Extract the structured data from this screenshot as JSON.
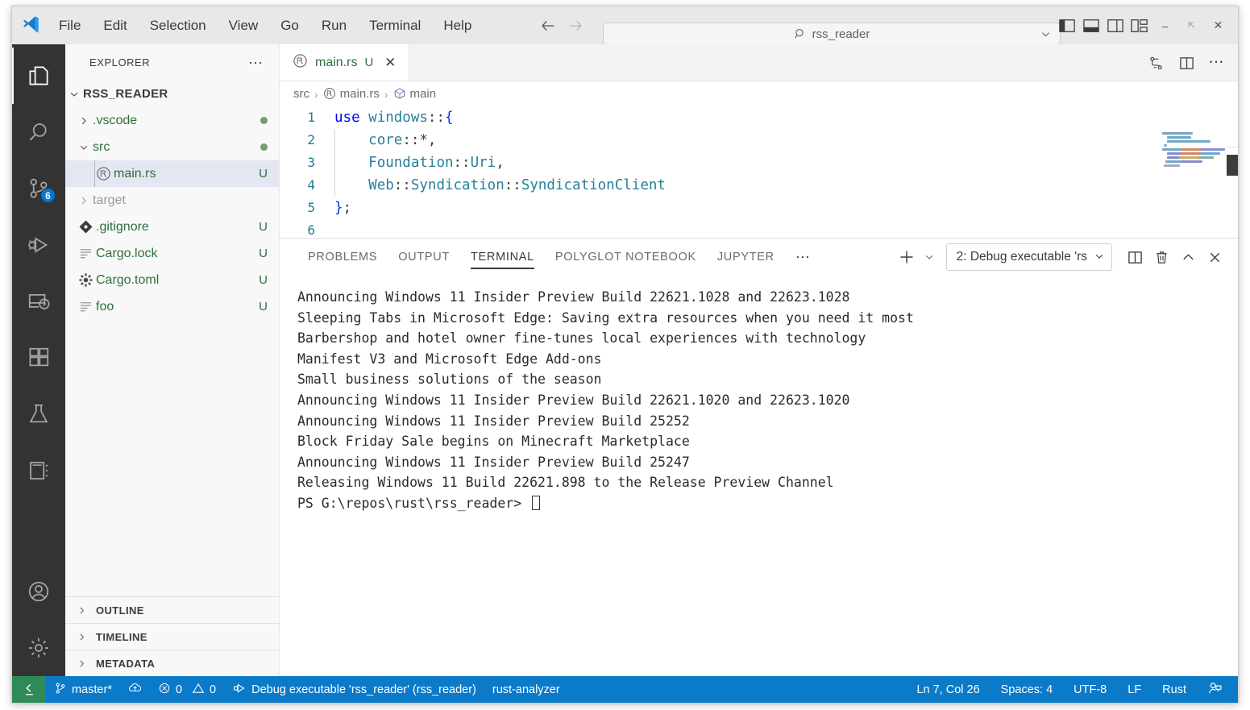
{
  "titlebar": {
    "logo_icon": "vscode-logo-icon",
    "menus": [
      "File",
      "Edit",
      "Selection",
      "View",
      "Go",
      "Run",
      "Terminal",
      "Help"
    ],
    "nav_back_icon": "arrow-left-icon",
    "nav_forward_icon": "arrow-right-icon",
    "search": {
      "icon": "search-icon",
      "value": "rss_reader",
      "chevron_icon": "chevron-down-icon"
    },
    "layout_controls": [
      {
        "name": "toggle-primary-sidebar-icon"
      },
      {
        "name": "toggle-panel-icon"
      },
      {
        "name": "toggle-secondary-sidebar-icon"
      },
      {
        "name": "customize-layout-icon"
      }
    ],
    "window_controls": {
      "minimize": "–",
      "maximize": "❐",
      "close": "✕"
    }
  },
  "activitybar": {
    "items": [
      {
        "name": "explorer",
        "icon": "files-icon",
        "active": true,
        "badge": ""
      },
      {
        "name": "search",
        "icon": "search-icon",
        "active": false,
        "badge": ""
      },
      {
        "name": "source-control",
        "icon": "source-control-icon",
        "active": false,
        "badge": "6"
      },
      {
        "name": "run-and-debug",
        "icon": "run-debug-icon",
        "active": false,
        "badge": ""
      },
      {
        "name": "remote-explorer",
        "icon": "remote-explorer-icon",
        "active": false,
        "badge": ""
      },
      {
        "name": "extensions",
        "icon": "extensions-icon",
        "active": false,
        "badge": ""
      },
      {
        "name": "testing",
        "icon": "beaker-icon",
        "active": false,
        "badge": ""
      },
      {
        "name": "notebook",
        "icon": "notebook-icon",
        "active": false,
        "badge": ""
      }
    ],
    "bottom_items": [
      {
        "name": "accounts",
        "icon": "account-icon"
      },
      {
        "name": "manage",
        "icon": "gear-icon"
      }
    ]
  },
  "sidebar": {
    "title": "EXPLORER",
    "more_actions": "⋯",
    "root": {
      "label": "RSS_READER",
      "expanded": true
    },
    "tree": [
      {
        "label": ".vscode",
        "type": "folder",
        "expanded": false,
        "indent": 1,
        "status": "",
        "dot": true,
        "dim": false,
        "icon": ""
      },
      {
        "label": "src",
        "type": "folder",
        "expanded": true,
        "indent": 1,
        "status": "",
        "dot": true,
        "dim": false,
        "icon": ""
      },
      {
        "label": "main.rs",
        "type": "file",
        "indent": 2,
        "status": "U",
        "dot": false,
        "dim": false,
        "selected": true,
        "icon": "rust-icon"
      },
      {
        "label": "target",
        "type": "folder",
        "expanded": false,
        "indent": 1,
        "status": "",
        "dot": false,
        "dim": true,
        "icon": ""
      },
      {
        "label": ".gitignore",
        "type": "file",
        "indent": 1,
        "status": "U",
        "dot": false,
        "dim": false,
        "icon": "git-icon"
      },
      {
        "label": "Cargo.lock",
        "type": "file",
        "indent": 1,
        "status": "U",
        "dot": false,
        "dim": false,
        "icon": "lock-file-icon"
      },
      {
        "label": "Cargo.toml",
        "type": "file",
        "indent": 1,
        "status": "U",
        "dot": false,
        "dim": false,
        "icon": "gear-icon"
      },
      {
        "label": "foo",
        "type": "file",
        "indent": 1,
        "status": "U",
        "dot": false,
        "dim": false,
        "icon": "text-file-icon"
      }
    ],
    "sections": [
      {
        "label": "OUTLINE",
        "expanded": false
      },
      {
        "label": "TIMELINE",
        "expanded": false
      },
      {
        "label": "METADATA",
        "expanded": false
      }
    ]
  },
  "editor": {
    "tab": {
      "filename": "main.rs",
      "icon": "rust-icon",
      "status": "U",
      "close_icon": "✕"
    },
    "tab_actions": [
      {
        "name": "split-changes-icon"
      },
      {
        "name": "split-editor-icon"
      },
      {
        "name": "more-actions-icon"
      }
    ],
    "breadcrumb": [
      {
        "label": "src",
        "icon": ""
      },
      {
        "label": "main.rs",
        "icon": "rust-icon"
      },
      {
        "label": "main",
        "icon": "symbol-method-icon"
      }
    ],
    "breadcrumb_separator": "›",
    "lines": [
      {
        "num": "1",
        "segments": [
          {
            "t": "use ",
            "c": "kw"
          },
          {
            "t": "windows",
            "c": "mod"
          },
          {
            "t": "::",
            "c": "punct"
          },
          {
            "t": "{",
            "c": "brace"
          }
        ],
        "indent_guide": false
      },
      {
        "num": "2",
        "segments": [
          {
            "t": "    ",
            "c": "punct"
          },
          {
            "t": "core",
            "c": "mod"
          },
          {
            "t": "::*,",
            "c": "punct"
          }
        ],
        "indent_guide": true
      },
      {
        "num": "3",
        "segments": [
          {
            "t": "    ",
            "c": "punct"
          },
          {
            "t": "Foundation",
            "c": "mod"
          },
          {
            "t": "::",
            "c": "punct"
          },
          {
            "t": "Uri",
            "c": "mod"
          },
          {
            "t": ",",
            "c": "punct"
          }
        ],
        "indent_guide": true
      },
      {
        "num": "4",
        "segments": [
          {
            "t": "    ",
            "c": "punct"
          },
          {
            "t": "Web",
            "c": "mod"
          },
          {
            "t": "::",
            "c": "punct"
          },
          {
            "t": "Syndication",
            "c": "mod"
          },
          {
            "t": "::",
            "c": "punct"
          },
          {
            "t": "SyndicationClient",
            "c": "mod"
          }
        ],
        "indent_guide": true
      },
      {
        "num": "5",
        "segments": [
          {
            "t": "}",
            "c": "brace"
          },
          {
            "t": ";",
            "c": "punct"
          }
        ],
        "indent_guide": false
      },
      {
        "num": "6",
        "segments": [],
        "indent_guide": false
      }
    ]
  },
  "panel": {
    "tabs": [
      {
        "label": "PROBLEMS",
        "active": false
      },
      {
        "label": "OUTPUT",
        "active": false
      },
      {
        "label": "TERMINAL",
        "active": true
      },
      {
        "label": "POLYGLOT NOTEBOOK",
        "active": false
      },
      {
        "label": "JUPYTER",
        "active": false
      }
    ],
    "more_tabs": "⋯",
    "new_terminal_icon": "plus-icon",
    "new_terminal_chevron": "chevron-down-icon",
    "terminal_selector": {
      "value": "2: Debug executable 'rs",
      "chevron_icon": "chevron-down-icon"
    },
    "actions": [
      {
        "name": "split-terminal-icon"
      },
      {
        "name": "kill-terminal-icon"
      },
      {
        "name": "maximize-panel-icon"
      },
      {
        "name": "close-panel-icon"
      }
    ],
    "terminal_output": [
      "Announcing Windows 11 Insider Preview Build 22621.1028 and 22623.1028",
      "Sleeping Tabs in Microsoft Edge: Saving extra resources when you need it most",
      "Barbershop and hotel owner fine-tunes local experiences with technology",
      "Manifest V3 and Microsoft Edge Add-ons",
      "Small business solutions of the season",
      "Announcing Windows 11 Insider Preview Build 22621.1020 and 22623.1020",
      "Announcing Windows 11 Insider Preview Build 25252",
      "Block Friday Sale begins on Minecraft Marketplace",
      "Announcing Windows 11 Insider Preview Build 25247",
      "Releasing Windows 11 Build 22621.898 to the Release Preview Channel"
    ],
    "terminal_prompt": "PS G:\\repos\\rust\\rss_reader> "
  },
  "statusbar": {
    "remote_icon": "remote-window-icon",
    "branch": {
      "icon": "source-control-icon",
      "label": "master*"
    },
    "sync_icon": "sync-cloud-icon",
    "errors": {
      "icon": "error-icon",
      "count": "0"
    },
    "warnings": {
      "icon": "warning-icon",
      "count": "0"
    },
    "debug_target": {
      "icon": "run-debug-icon",
      "label": "Debug executable 'rss_reader' (rss_reader)"
    },
    "language_server": "rust-analyzer",
    "cursor_position": "Ln 7, Col 26",
    "indentation": "Spaces: 4",
    "encoding": "UTF-8",
    "eol": "LF",
    "language_mode": "Rust",
    "feedback_icon": "feedback-icon",
    "background_color": "#0a7ac9",
    "remote_color": "#2e8b57"
  }
}
